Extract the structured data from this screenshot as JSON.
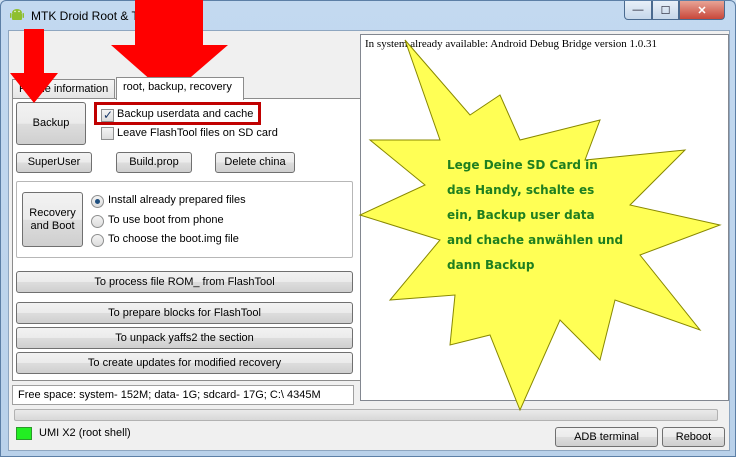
{
  "window": {
    "title": "MTK Droid Root & Tools",
    "controls": {
      "minimize": "—",
      "maximize": "☐",
      "close": "✕"
    }
  },
  "tabs": [
    {
      "label": "Phone information"
    },
    {
      "label": "root, backup, recovery"
    }
  ],
  "backup": {
    "button_label": "Backup",
    "checkbox_backup_userdata": {
      "label": "Backup userdata and cache",
      "checked": true
    },
    "checkbox_leave_flashtool": {
      "label": "Leave FlashTool files on SD card",
      "checked": false
    }
  },
  "buttons_row": {
    "superuser": "SuperUser",
    "buildprop": "Build.prop",
    "delete_china": "Delete china"
  },
  "recovery": {
    "button_label": "Recovery and Boot",
    "options": [
      {
        "label": "Install already prepared files",
        "selected": true
      },
      {
        "label": "To use boot from phone",
        "selected": false
      },
      {
        "label": "To choose the boot.img file",
        "selected": false
      }
    ]
  },
  "actions": {
    "process_rom": "To process file ROM_ from FlashTool",
    "prepare_blocks": "To prepare blocks for FlashTool",
    "unpack_yaffs2": "To unpack yaffs2 the section",
    "create_updates": "To create updates for modified recovery"
  },
  "console": {
    "line1": "In system already available:  Android Debug Bridge version 1.0.31"
  },
  "freespace": "Free space: system- 152M; data- 1G; sdcard- 17G;  C:\\ 4345M",
  "status": {
    "device": "UMI X2 (root shell)",
    "led_color": "#22ee22"
  },
  "footer_buttons": {
    "adb_terminal": "ADB terminal",
    "reboot": "Reboot"
  },
  "annotation": {
    "star_text_lines": [
      "Lege Deine SD Card in",
      "das Handy, schalte es",
      "ein, Backup user data",
      "and chache anwählen und",
      "dann Backup"
    ],
    "colors": {
      "arrow": "#ff0000",
      "star_fill": "#ffff55",
      "star_text": "#1f7f1f",
      "highlight": "#c00000"
    }
  }
}
